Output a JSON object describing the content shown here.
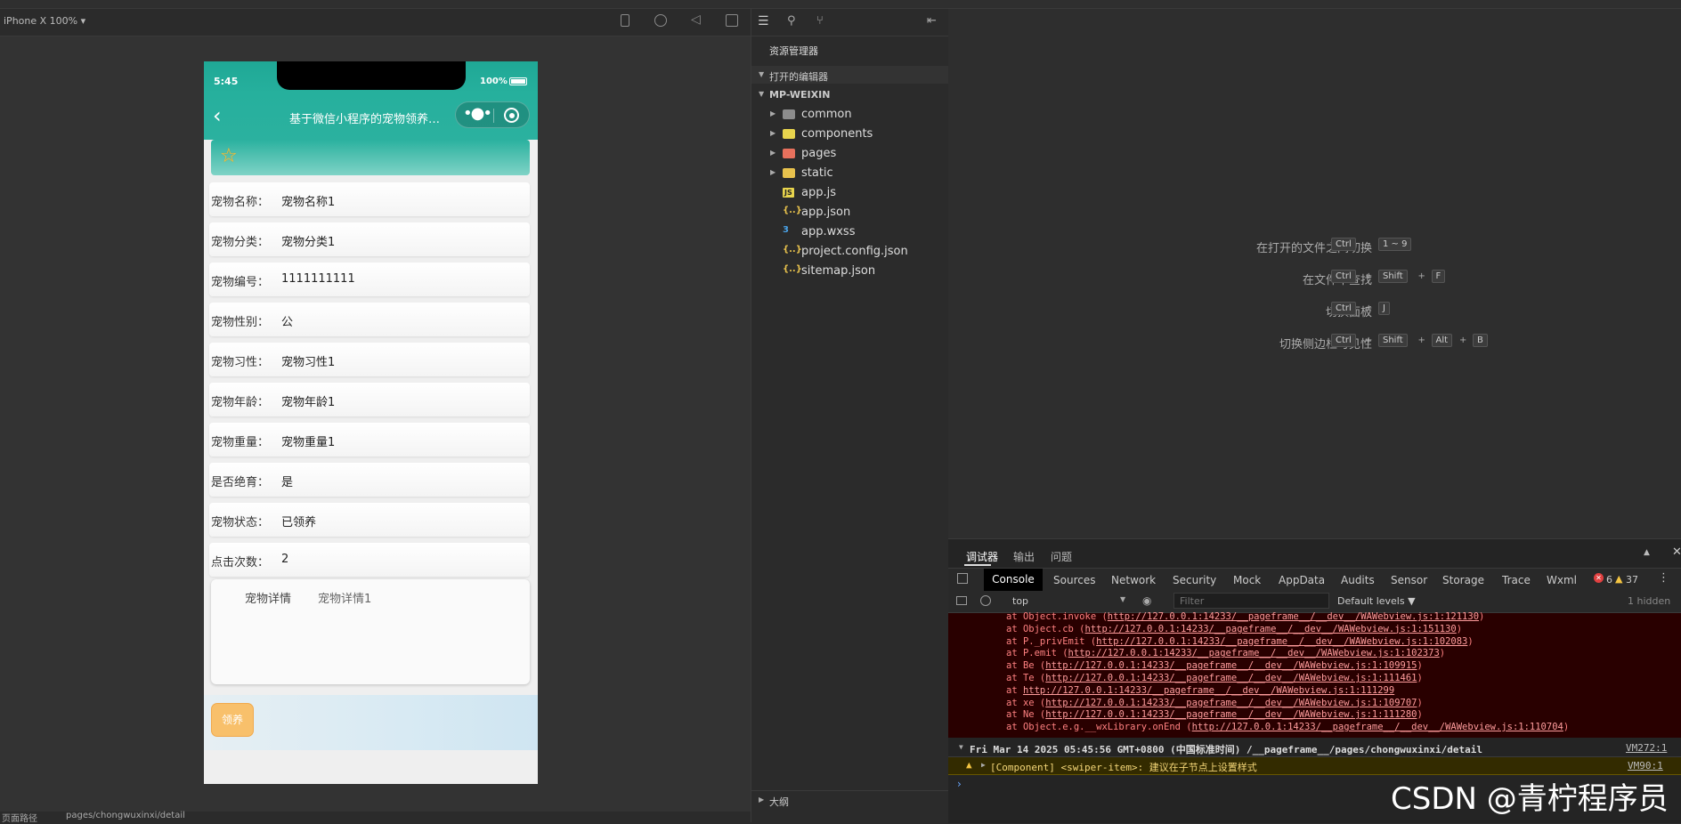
{
  "device": {
    "label": "iPhone X 100% ▾"
  },
  "phone": {
    "time": "5:45",
    "battery": "100%",
    "nav_title": "基于微信小程序的宠物领养平...",
    "fields": [
      {
        "label": "宠物名称：",
        "value": "宠物名称1"
      },
      {
        "label": "宠物分类：",
        "value": "宠物分类1"
      },
      {
        "label": "宠物编号：",
        "value": "1111111111"
      },
      {
        "label": "宠物性别：",
        "value": "公"
      },
      {
        "label": "宠物习性：",
        "value": "宠物习性1"
      },
      {
        "label": "宠物年龄：",
        "value": "宠物年龄1"
      },
      {
        "label": "宠物重量：",
        "value": "宠物重量1"
      },
      {
        "label": "是否绝育：",
        "value": "是"
      },
      {
        "label": "宠物状态：",
        "value": "已领养"
      },
      {
        "label": "点击次数：",
        "value": "2"
      }
    ],
    "detail_label": "宠物详情",
    "detail_value": "宠物详情1",
    "adopt_button": "领养"
  },
  "explorer": {
    "title": "资源管理器",
    "open_editors": "打开的编辑器",
    "project": "MP-WEIXIN",
    "items": [
      {
        "name": "common",
        "kind": "folder",
        "color": "#8c8c8c"
      },
      {
        "name": "components",
        "kind": "folder",
        "color": "#e8d44d"
      },
      {
        "name": "pages",
        "kind": "folder",
        "color": "#e8715d"
      },
      {
        "name": "static",
        "kind": "folder",
        "color": "#e8c24d"
      },
      {
        "name": "app.js",
        "kind": "js",
        "icon": "JS"
      },
      {
        "name": "app.json",
        "kind": "json",
        "icon": "{..}"
      },
      {
        "name": "app.wxss",
        "kind": "css",
        "icon": "3"
      },
      {
        "name": "project.config.json",
        "kind": "json",
        "icon": "{..}"
      },
      {
        "name": "sitemap.json",
        "kind": "json",
        "icon": "{..}"
      }
    ],
    "outline": "大纲"
  },
  "welcome": {
    "shortcuts": [
      {
        "label": "在打开的文件之间切换",
        "keys": [
          "Ctrl",
          "1 ~ 9"
        ],
        "seps": [
          ""
        ]
      },
      {
        "label": "在文件中查找",
        "keys": [
          "Ctrl",
          "Shift",
          "F"
        ],
        "seps": [
          "+",
          "+"
        ]
      },
      {
        "label": "切换面板",
        "keys": [
          "Ctrl",
          "J"
        ],
        "seps": [
          "+"
        ]
      },
      {
        "label": "切换侧边栏可见性",
        "keys": [
          "Ctrl",
          "Shift",
          "Alt",
          "B"
        ],
        "seps": [
          "+",
          "+",
          "+"
        ]
      }
    ]
  },
  "devtools": {
    "tabs": [
      "调试器",
      "输出",
      "问题"
    ],
    "panels": [
      "Console",
      "Sources",
      "Network",
      "Security",
      "Mock",
      "AppData",
      "Audits",
      "Sensor",
      "Storage",
      "Trace",
      "Wxml"
    ],
    "errors": "6",
    "warnings": "37",
    "context": "top",
    "filter_placeholder": "Filter",
    "levels": "Default levels ▼",
    "hidden": "1 hidden",
    "stack": [
      {
        "prefix": "at Object.invoke (",
        "url": "http://127.0.0.1:14233/__pageframe__/__dev__/WAWebview.js:1:121130",
        "suffix": ")"
      },
      {
        "prefix": "at Object.cb (",
        "url": "http://127.0.0.1:14233/__pageframe__/__dev__/WAWebview.js:1:151130",
        "suffix": ")"
      },
      {
        "prefix": "at P._privEmit (",
        "url": "http://127.0.0.1:14233/__pageframe__/__dev__/WAWebview.js:1:102083",
        "suffix": ")"
      },
      {
        "prefix": "at P.emit (",
        "url": "http://127.0.0.1:14233/__pageframe__/__dev__/WAWebview.js:1:102373",
        "suffix": ")"
      },
      {
        "prefix": "at Be (",
        "url": "http://127.0.0.1:14233/__pageframe__/__dev__/WAWebview.js:1:109915",
        "suffix": ")"
      },
      {
        "prefix": "at Te (",
        "url": "http://127.0.0.1:14233/__pageframe__/__dev__/WAWebview.js:1:111461",
        "suffix": ")"
      },
      {
        "prefix": "at ",
        "url": "http://127.0.0.1:14233/__pageframe__/__dev__/WAWebview.js:1:111299",
        "suffix": ""
      },
      {
        "prefix": "at xe (",
        "url": "http://127.0.0.1:14233/__pageframe__/__dev__/WAWebview.js:1:109707",
        "suffix": ")"
      },
      {
        "prefix": "at Ne (",
        "url": "http://127.0.0.1:14233/__pageframe__/__dev__/WAWebview.js:1:111280",
        "suffix": ")"
      },
      {
        "prefix": "at Object.e.g.__wxLibrary.onEnd (",
        "url": "http://127.0.0.1:14233/__pageframe__/__dev__/WAWebview.js:1:110704",
        "suffix": ")"
      }
    ],
    "log": "Fri Mar 14 2025 05:45:56 GMT+0800 (中国标准时间) /__pageframe__/pages/chongwuxinxi/detail",
    "log_src": "VM272:1",
    "warn": "[Component] <swiper-item>: 建议在子节点上设置样式",
    "warn_src": "VM90:1",
    "prompt": "›"
  },
  "watermark": "CSDN @青柠程序员",
  "footer": {
    "path_label": "页面路径",
    "path": "pages/chongwuxinxi/detail"
  },
  "colors": {
    "accent": "#26b09d",
    "button": "#f8c06b"
  }
}
